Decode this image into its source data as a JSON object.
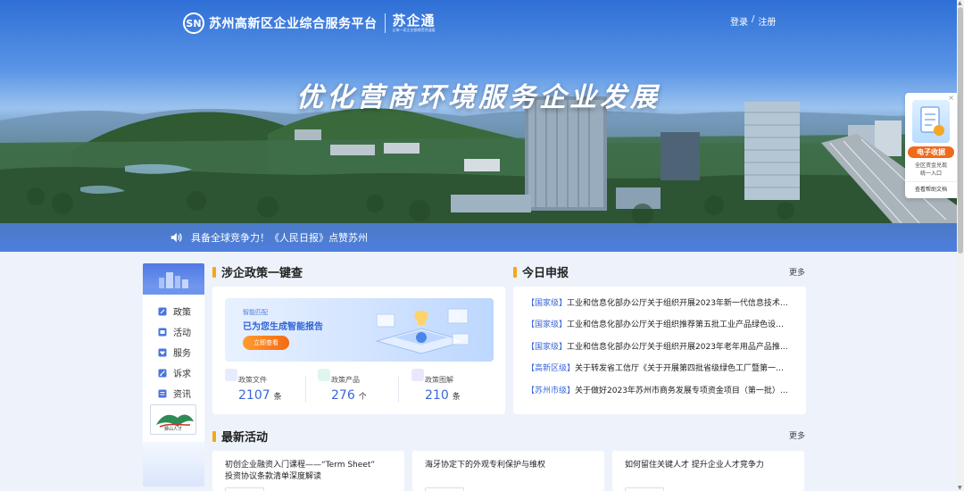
{
  "header": {
    "logo_mark": "SN",
    "site_title": "苏州高新区企业综合服务平台",
    "sub_brand": "苏企通",
    "sub_brand_tagline": "让每一家企业都感受到温暖",
    "login": "登录",
    "separator": "/",
    "register": "注册"
  },
  "hero": {
    "slogan": "优化营商环境服务企业发展"
  },
  "ticker": {
    "icon": "speaker-icon",
    "text": "具备全球竞争力！《人民日报》点赞苏州"
  },
  "float_widget": {
    "close": "×",
    "tag": "电子收据",
    "desc_line1": "全区资金兑现",
    "desc_line2": "统一入口",
    "help": "查看帮助文档"
  },
  "sidebar": {
    "items": [
      {
        "label": "政策",
        "icon": "edit-icon"
      },
      {
        "label": "活动",
        "icon": "calendar-icon"
      },
      {
        "label": "服务",
        "icon": "heart-icon"
      },
      {
        "label": "诉求",
        "icon": "pen-icon"
      },
      {
        "label": "资讯",
        "icon": "news-icon"
      }
    ],
    "partner_logo_text": "狮山人才"
  },
  "policy_section": {
    "title": "涉企政策一键查",
    "ai_tag": "智能匹配",
    "ai_title": "已为您生成智能报告",
    "ai_button": "立即查看",
    "stats": [
      {
        "label": "政策文件",
        "value": "2107",
        "unit": "条",
        "color": "#6b8cf0"
      },
      {
        "label": "政策产品",
        "value": "276",
        "unit": "个",
        "color": "#34c38f"
      },
      {
        "label": "政策图解",
        "value": "210",
        "unit": "条",
        "color": "#9b7cf0"
      }
    ]
  },
  "declaration_section": {
    "title": "今日申报",
    "more": "更多",
    "items": [
      {
        "tag": "【国家级】",
        "text": "工业和信息化部办公厅关于组织开展2023年新一代信息技术…"
      },
      {
        "tag": "【国家级】",
        "text": "工业和信息化部办公厅关于组织推荐第五批工业产品绿色设…"
      },
      {
        "tag": "【国家级】",
        "text": "工业和信息化部办公厅关于组织开展2023年老年用品产品推…"
      },
      {
        "tag": "【高新区级】",
        "text": "关于转发省工信厅《关于开展第四批省级绿色工厂暨第一…"
      },
      {
        "tag": "【苏州市级】",
        "text": "关于做好2023年苏州市商务发展专项资金项目（第一批）…"
      }
    ]
  },
  "activity_section": {
    "title": "最新活动",
    "more": "更多",
    "items": [
      {
        "line1": "初创企业融资入门课程——“Term Sheet”",
        "line2": "投资协议条款清单深度解读"
      },
      {
        "line1": "海牙协定下的外观专利保护与维权",
        "line2": ""
      },
      {
        "line1": "如何留住关键人才 提升企业人才竞争力",
        "line2": ""
      }
    ]
  },
  "colors": {
    "accent": "#3a66d8",
    "section_bar": "#f4a81b",
    "cta": "#f46b12"
  }
}
